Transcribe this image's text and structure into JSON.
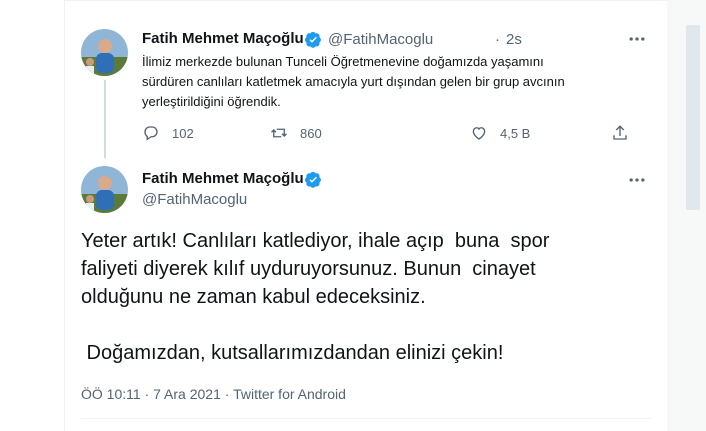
{
  "parent_tweet": {
    "author_name": "Fatih Mehmet Maçoğlu",
    "handle": "@FatihMacoglu",
    "separator": "·",
    "time": "2s",
    "text_lines": [
      "İlimiz merkezde  bulunan Tunceli Öğretmenevine  doğamızda yaşamını",
      "sürdüren canlıları katletmek amacıyla yurt dışından gelen bir grup avcının",
      "yerleştirildiğini öğrendik."
    ],
    "replies": "102",
    "retweets": "860",
    "likes": "4,5 B",
    "icons": {
      "more": "more-dots-icon",
      "reply": "reply-icon",
      "retweet": "retweet-icon",
      "like": "like-icon",
      "share": "share-icon",
      "verified": "verified-badge-icon"
    }
  },
  "main_tweet": {
    "author_name": "Fatih Mehmet Maçoğlu",
    "handle": "@FatihMacoglu",
    "text_lines": [
      "Yeter artık! Canlıları katlediyor, ihale açıp  buna  spor",
      "faliyeti diyerek kılıf uyduruyorsunuz. Bunun  cinayet",
      "olduğunu ne zaman kabul edeceksiniz."
    ],
    "text_line_last": " Doğamızdan, kutsallarımızdandan elinizi çekin!",
    "meta_time": "ÖÖ 10:11",
    "meta_sep1": "·",
    "meta_date": "7 Ara 2021",
    "meta_sep2": "·",
    "meta_source": "Twitter for Android"
  },
  "colors": {
    "verified": "#1d9bf0",
    "muted": "#536471",
    "text": "#0f1419",
    "thread_line": "#cfd9de",
    "border": "#eff3f4"
  }
}
